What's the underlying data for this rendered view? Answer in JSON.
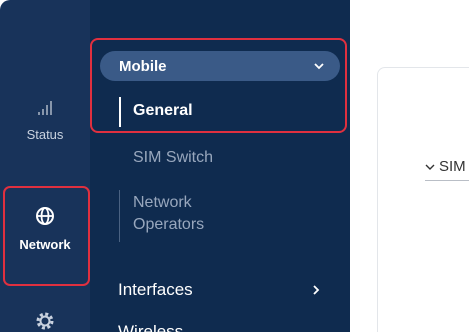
{
  "rail": {
    "items": [
      {
        "label": "Status",
        "icon": "signal-icon"
      },
      {
        "label": "Network",
        "icon": "globe-icon"
      },
      {
        "label": "",
        "icon": "gear-icon"
      }
    ]
  },
  "menu": {
    "mobile_label": "Mobile",
    "mobile_sub": [
      "General",
      "SIM Switch",
      "Network Operators"
    ],
    "network_operators_lines": [
      "Network",
      "Operators"
    ],
    "items": [
      "Interfaces",
      "Wireless"
    ]
  },
  "content": {
    "section_label": "SIM"
  },
  "colors": {
    "rail_bg": "#18335a",
    "submenu_bg": "#0f2b4f",
    "active_pill": "#3a5a87",
    "highlight": "#e0303f"
  }
}
